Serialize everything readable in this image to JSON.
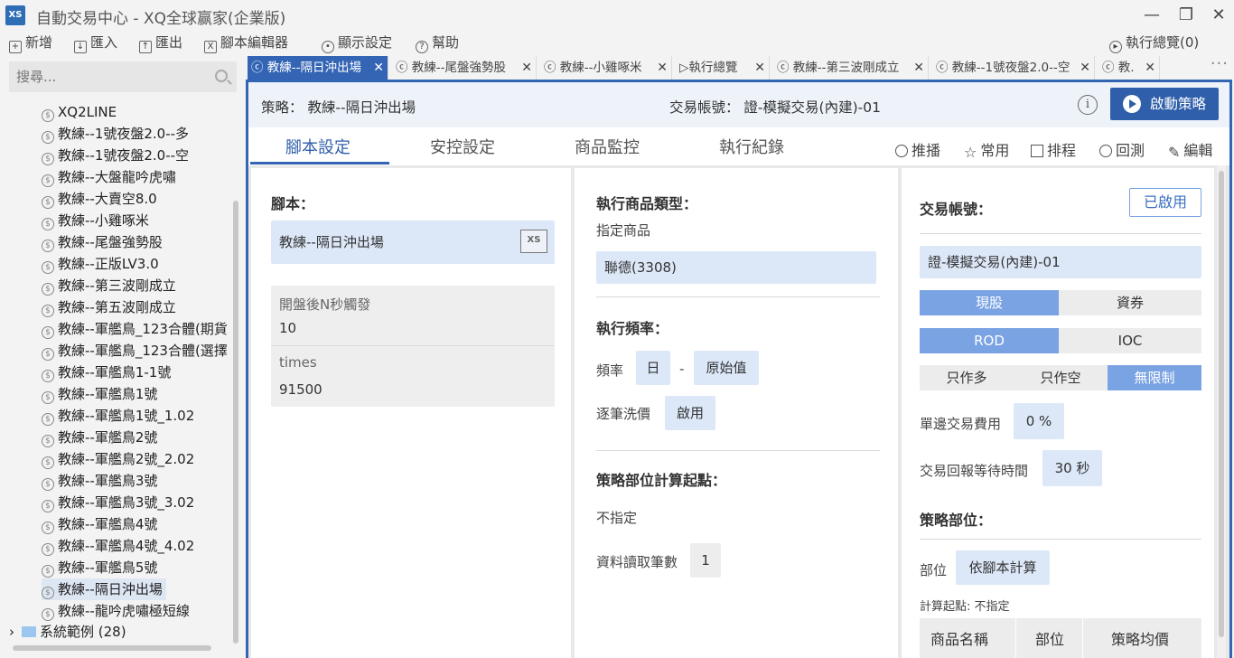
{
  "window": {
    "app_logo": "XS",
    "title": "自動交易中心 - XQ全球赢家(企業版)",
    "min_icon": "minimize-icon",
    "max_icon": "maximize-icon",
    "close_icon": "close-icon"
  },
  "menu": {
    "new": "新增",
    "import": "匯入",
    "export": "匯出",
    "script_editor": "腳本編輯器",
    "display_settings": "顯示設定",
    "help": "幫助",
    "exec_overview": "執行總覽(0)"
  },
  "sidebar": {
    "search_placeholder": "搜尋...",
    "items": [
      "XQ2LINE",
      "教練--1號夜盤2.0--多",
      "教練--1號夜盤2.0--空",
      "教練--大盤龍吟虎嘯",
      "教練--大賣空8.0",
      "教練--小雞啄米",
      "教練--尾盤強勢股",
      "教練--正版LV3.0",
      "教練--第三波剛成立",
      "教練--第五波剛成立",
      "教練--軍艦鳥_123合體(期貨",
      "教練--軍艦鳥_123合體(選擇",
      "教練--軍艦鳥1-1號",
      "教練--軍艦鳥1號",
      "教練--軍艦鳥1號_1.02",
      "教練--軍艦鳥2號",
      "教練--軍艦鳥2號_2.02",
      "教練--軍艦鳥3號",
      "教練--軍艦鳥3號_3.02",
      "教練--軍艦鳥4號",
      "教練--軍艦鳥4號_4.02",
      "教練--軍艦鳥5號",
      "教練--隔日沖出場",
      "教練--龍吟虎嘯極短線"
    ],
    "selected_index": 22,
    "folder": "系統範例 (28)"
  },
  "tabs": [
    {
      "label": "教練--隔日沖出場",
      "active": true
    },
    {
      "label": "教練--尾盤強勢股",
      "active": false
    },
    {
      "label": "教練--小雞啄米",
      "active": false
    },
    {
      "label": "執行總覽",
      "active": false
    },
    {
      "label": "教練--第三波剛成立",
      "active": false
    },
    {
      "label": "教練--1號夜盤2.0--空",
      "active": false
    },
    {
      "label": "教.",
      "active": false
    }
  ],
  "header": {
    "strategy_label": "策略： 教練--隔日沖出場",
    "account_label": "交易帳號： 證-模擬交易(內建)-01",
    "start_button": "啟動策略"
  },
  "subtabs": [
    "腳本設定",
    "安控設定",
    "商品監控",
    "執行紀錄"
  ],
  "tools": {
    "push": "推播",
    "favorite": "常用",
    "schedule": "排程",
    "backtest": "回測",
    "edit": "編輯"
  },
  "left_panel": {
    "script_label": "腳本：",
    "script_value": "教練--隔日沖出場",
    "params": [
      {
        "name": "開盤後N秒觸發",
        "value": "10"
      },
      {
        "name": "times",
        "value": "91500"
      }
    ]
  },
  "middle_panel": {
    "product_type_label": "執行商品類型：",
    "product_type": "指定商品",
    "product": "聯德(3308)",
    "freq_label": "執行頻率：",
    "freq_text": "頻率",
    "freq_value": "日",
    "freq_dash": "-",
    "freq_mode": "原始值",
    "tick_wash_text": "逐筆洗價",
    "tick_wash_value": "啟用",
    "position_calc_label": "策略部位計算起點：",
    "position_calc_value": "不指定",
    "data_count_text": "資料讀取筆數",
    "data_count_value": "1"
  },
  "right_panel": {
    "account_label": "交易帳號：",
    "enabled_button": "已啟用",
    "account_value": "證-模擬交易(內建)-01",
    "trade_type": [
      "現股",
      "資券"
    ],
    "order_type": [
      "ROD",
      "IOC"
    ],
    "direction": [
      "只作多",
      "只作空",
      "無限制"
    ],
    "fee_text": "單邊交易費用",
    "fee_value": "0 %",
    "wait_text": "交易回報等待時間",
    "wait_value": "30 秒",
    "position_label": "策略部位：",
    "position_text": "部位",
    "position_value": "依腳本計算",
    "calc_start": "計算起點: 不指定",
    "table_headers": [
      "商品名稱",
      "部位",
      "策略均價"
    ]
  }
}
